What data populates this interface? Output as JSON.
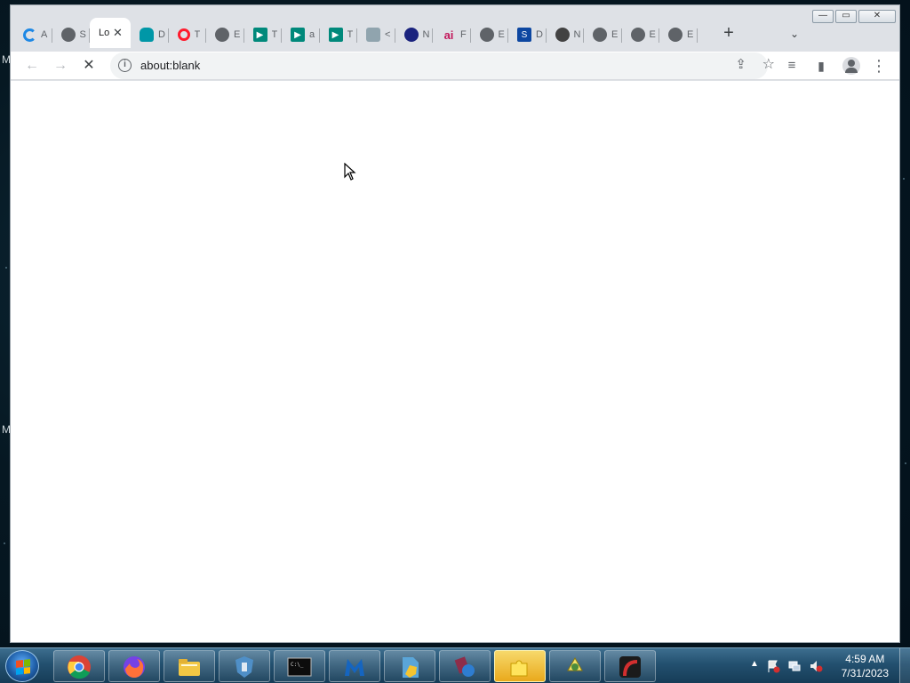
{
  "desktop": {
    "edge_labels": [
      "M",
      "M"
    ]
  },
  "browser": {
    "tabs": [
      {
        "icon": "loading-spinner-icon",
        "title": "A",
        "active": false
      },
      {
        "icon": "globe-icon",
        "title": "S",
        "active": false
      },
      {
        "icon": "blank-page-icon",
        "title": "Lo",
        "active": true
      },
      {
        "icon": "cloud-icon",
        "title": "D",
        "active": false
      },
      {
        "icon": "opera-icon",
        "title": "T",
        "active": false
      },
      {
        "icon": "globe-icon",
        "title": "E",
        "active": false
      },
      {
        "icon": "play-icon",
        "title": "T",
        "active": false
      },
      {
        "icon": "play-icon",
        "title": "a",
        "active": false
      },
      {
        "icon": "play-icon",
        "title": "T",
        "active": false
      },
      {
        "icon": "bird-icon",
        "title": "<",
        "active": false
      },
      {
        "icon": "globe-icon",
        "title": "N",
        "active": false
      },
      {
        "icon": "ai-icon",
        "title": "F",
        "active": false
      },
      {
        "icon": "globe-icon",
        "title": "E",
        "active": false
      },
      {
        "icon": "square-logo-icon",
        "title": "D",
        "active": false
      },
      {
        "icon": "chrome-icon",
        "title": "N",
        "active": false
      },
      {
        "icon": "globe-icon",
        "title": "E",
        "active": false
      },
      {
        "icon": "globe-icon",
        "title": "E",
        "active": false
      },
      {
        "icon": "globe-icon",
        "title": "E",
        "active": false
      }
    ],
    "active_tab_close": "✕",
    "new_tab_label": "+",
    "tab_search_label": "⌄",
    "window_controls": {
      "minimize": "—",
      "maximize": "▭",
      "close": "✕"
    },
    "toolbar": {
      "back": "←",
      "forward": "→",
      "stop": "✕",
      "info": "i",
      "url": "about:blank",
      "share": "⇪",
      "bookmark": "☆",
      "reading_list": "≡",
      "side_panel": "▮",
      "menu": "⋮"
    }
  },
  "taskbar": {
    "apps": [
      "chrome-icon",
      "firefox-icon",
      "file-explorer-icon",
      "shield-tool-icon",
      "terminal-icon",
      "malwarebytes-icon",
      "security-shield-icon",
      "network-tool-icon",
      "puzzle-icon",
      "recycle-tool-icon",
      "red-app-icon"
    ],
    "clock": {
      "time": "4:59 AM",
      "date": "7/31/2023"
    },
    "tray_arrow": "▲"
  },
  "colors": {
    "accent": "#1a73e8",
    "taskbar_top": "#3d6e8f",
    "taskbar_bottom": "#163c57",
    "tab_strip": "#dee1e6"
  }
}
